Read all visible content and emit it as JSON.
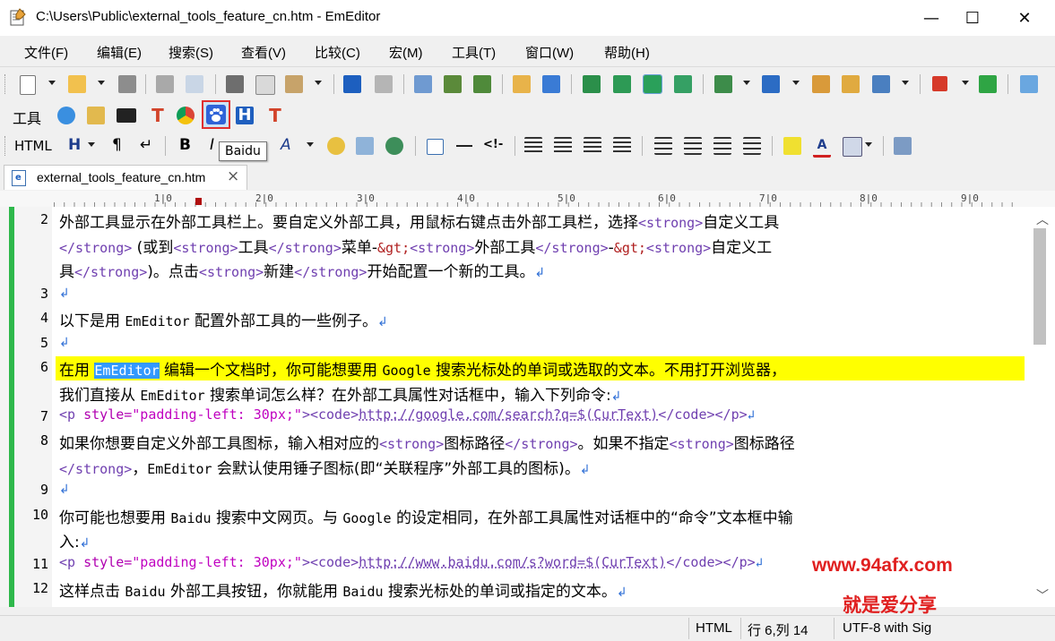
{
  "window": {
    "title": "C:\\Users\\Public\\external_tools_feature_cn.htm - EmEditor",
    "minimize": "—",
    "maximize": "☐",
    "close": "✕"
  },
  "menu": [
    "文件(F)",
    "编辑(E)",
    "搜索(S)",
    "查看(V)",
    "比较(C)",
    "宏(M)",
    "工具(T)",
    "窗口(W)",
    "帮助(H)"
  ],
  "tools_toolbar": {
    "label": "工具"
  },
  "html_toolbar": {
    "label": "HTML",
    "heading": "H",
    "para": "¶",
    "enter": "↵",
    "bold": "B",
    "italic": "I",
    "comment": "<!-"
  },
  "tooltip": {
    "text": "Baidu"
  },
  "tab": {
    "label": "external_tools_feature_cn.htm",
    "close": "×"
  },
  "ruler": [
    "1|0",
    "2|0",
    "3|0",
    "4|0",
    "5|0",
    "6|0",
    "7|0",
    "8|0",
    "9|0"
  ],
  "editor": {
    "line_numbers": [
      "2",
      "3",
      "4",
      "5",
      "6",
      "7",
      "8",
      "9",
      "10",
      "11",
      "12"
    ],
    "return_mark": "↲",
    "l2a_1": "外部工具显示在外部工具栏上。要自定义外部工具，用鼠标右键点击外部工具栏，选择",
    "l2a_tag": "<strong>",
    "l2a_2": "自定义工具",
    "l2b_tag1": "</strong>",
    "l2b_1": " (或到",
    "l2b_tag2": "<strong>",
    "l2b_2": "工具",
    "l2b_tag3": "</strong>",
    "l2b_3": "菜单-",
    "l2b_ent1": "&gt;",
    "l2b_tag4": "<strong>",
    "l2b_4": "外部工具",
    "l2b_tag5": "</strong>",
    "l2b_5": "-",
    "l2b_ent2": "&gt;",
    "l2b_tag6": "<strong>",
    "l2b_6": "自定义工",
    "l2c_1": "具",
    "l2c_tag1": "</strong>",
    "l2c_2": ")。点击",
    "l2c_tag2": "<strong>",
    "l2c_3": "新建",
    "l2c_tag3": "</strong>",
    "l2c_4": "开始配置一个新的工具。",
    "l4_1": "以下是用 ",
    "l4_2": "EmEditor",
    "l4_3": " 配置外部工具的一些例子。",
    "l6a_1": "在用 ",
    "l6a_sel": "EmEditor",
    "l6a_2": " 编辑一个文档时，你可能想要用 ",
    "l6a_3": "Google",
    "l6a_4": " 搜索光标处的单词或选取的文本。不用打开浏览器，",
    "l6b_1": "我们直接从 ",
    "l6b_2": "EmEditor",
    "l6b_3": " 搜索单词怎么样？在外部工具属性对话框中，输入下列命令:",
    "l7_tag1": "<p ",
    "l7_attr": "style=",
    "l7_str": "\"padding-left: 30px;\"",
    "l7_tag2": "><code>",
    "l7_url": "http://google.com/search?q=$(CurText)",
    "l7_tag3": "</code></p>",
    "l8a_1": "如果你想要自定义外部工具图标，输入相对应的",
    "l8a_tag1": "<strong>",
    "l8a_2": "图标路径",
    "l8a_tag2": "</strong>",
    "l8a_3": "。如果不指定",
    "l8a_tag3": "<strong>",
    "l8a_4": "图标路径",
    "l8b_tag1": "</strong>",
    "l8b_1": "，",
    "l8b_2": "EmEditor",
    "l8b_3": " 会默认使用锤子图标(即“关联程序”外部工具的图标)。",
    "l10a_1": "你可能也想要用 ",
    "l10a_2": "Baidu",
    "l10a_3": " 搜索中文网页。与 ",
    "l10a_4": "Google",
    "l10a_5": " 的设定相同，在外部工具属性对话框中的“命令”文本框中输",
    "l10b_1": "入:",
    "l11_tag1": "<p ",
    "l11_attr": "style=",
    "l11_str": "\"padding-left: 30px;\"",
    "l11_tag2": "><code>",
    "l11_url": "http://www.baidu.com/s?word=$(CurText)",
    "l11_tag3": "</code></p>",
    "l12_1": "这样点击 ",
    "l12_2": "Baidu",
    "l12_3": " 外部工具按钮，你就能用 ",
    "l12_4": "Baidu",
    "l12_5": " 搜索光标处的单词或指定的文本。"
  },
  "watermark": {
    "line1": "www.94afx.com",
    "line2": "就是爱分享"
  },
  "status": {
    "mode": "HTML",
    "position": "行 6,列 14",
    "encoding": "UTF-8 with Sig"
  },
  "colors": {
    "highlight": "#ffff00",
    "selection": "#3399ff",
    "gutter_bar": "#2eb84b",
    "watermark": "#e02020"
  }
}
